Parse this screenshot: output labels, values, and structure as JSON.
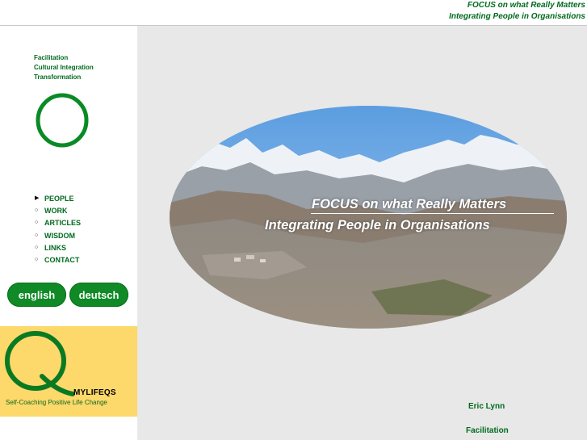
{
  "header": {
    "line1": "FOCUS on what Really Matters",
    "line2": "Integrating People in Organisations"
  },
  "sidebar": {
    "tagline": [
      "Facilitation",
      "Cultural Integration",
      "Transformation"
    ],
    "nav": [
      {
        "label": "PEOPLE",
        "marker": "▶"
      },
      {
        "label": "WORK",
        "marker": "○"
      },
      {
        "label": "ARTICLES",
        "marker": "○"
      },
      {
        "label": "WISDOM",
        "marker": "○"
      },
      {
        "label": "LINKS",
        "marker": "○"
      },
      {
        "label": "CONTACT",
        "marker": "○"
      }
    ],
    "languages": {
      "english": "english",
      "deutsch": "deutsch"
    },
    "promo": {
      "brand": "MYLIFEQS",
      "slogan": "Self-Coaching Positive Life Change"
    }
  },
  "hero": {
    "line1": "FOCUS on what Really Matters",
    "line2": "Integrating People in Organisations"
  },
  "footer": {
    "name": "Eric Lynn",
    "role": "Facilitation"
  },
  "colors": {
    "brand_green": "#006a1f",
    "button_green": "#0f8a26",
    "promo_yellow": "#fdd86b",
    "main_bg": "#e8e8e8"
  }
}
